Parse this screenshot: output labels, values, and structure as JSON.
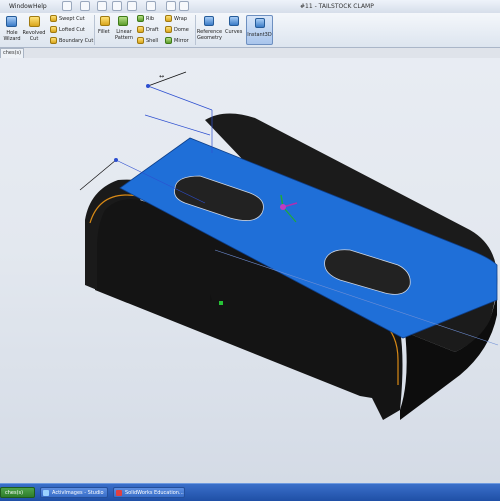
{
  "titlebar": {
    "menus": [
      "Window",
      "Help"
    ],
    "document_title": "#11 - TAILSTOCK CLAMP"
  },
  "ribbon": {
    "hole_wizard": "Hole Wizard",
    "revolved_cut": "Revolved Cut",
    "swept_cut": "Swept Cut",
    "lofted_cut": "Lofted Cut",
    "boundary_cut": "Boundary Cut",
    "fillet": "Fillet",
    "linear_pattern": "Linear Pattern",
    "rib": "Rib",
    "draft": "Draft",
    "shell": "Shell",
    "wrap": "Wrap",
    "dome": "Dome",
    "mirror": "Mirror",
    "reference_geometry": "Reference Geometry",
    "curves": "Curves",
    "instant3d": "Instant3D"
  },
  "tab_chip": "ches(s)",
  "taskbar": {
    "item1": "ches(s)",
    "item2": "ActivImages - Studio",
    "item3": "SolidWorks Education..."
  },
  "colors": {
    "selected_face": "#1f6fd8",
    "body": "#111111",
    "edge_highlight": "#d98a16",
    "taskbar": "#2856b0"
  }
}
